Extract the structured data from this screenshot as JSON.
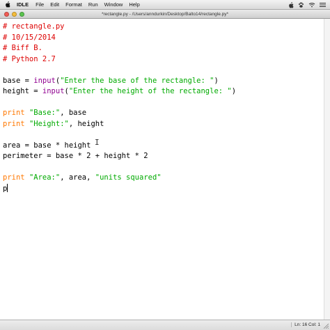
{
  "menubar": {
    "app_name": "IDLE",
    "items": [
      "File",
      "Edit",
      "Format",
      "Run",
      "Window",
      "Help"
    ],
    "status_icons": [
      "apple-icon",
      "paw-icon",
      "wifi-icon",
      "menu-icon"
    ]
  },
  "window": {
    "title": "*rectangle.py - /Users/anndurkin/Desktop/Balto14/rectangle.py*"
  },
  "editor": {
    "lines": [
      [
        {
          "t": "comment",
          "s": "# rectangle.py"
        }
      ],
      [
        {
          "t": "comment",
          "s": "# 10/15/2014"
        }
      ],
      [
        {
          "t": "comment",
          "s": "# Biff B."
        }
      ],
      [
        {
          "t": "comment",
          "s": "# Python 2.7"
        }
      ],
      [],
      [
        {
          "t": "plain",
          "s": "base = "
        },
        {
          "t": "builtin",
          "s": "input"
        },
        {
          "t": "plain",
          "s": "("
        },
        {
          "t": "string",
          "s": "\"Enter the base of the rectangle: \""
        },
        {
          "t": "plain",
          "s": ")"
        }
      ],
      [
        {
          "t": "plain",
          "s": "height = "
        },
        {
          "t": "builtin",
          "s": "input"
        },
        {
          "t": "plain",
          "s": "("
        },
        {
          "t": "string",
          "s": "\"Enter the height of the rectangle: \""
        },
        {
          "t": "plain",
          "s": ")"
        }
      ],
      [],
      [
        {
          "t": "keyword",
          "s": "print"
        },
        {
          "t": "plain",
          "s": " "
        },
        {
          "t": "string",
          "s": "\"Base:\""
        },
        {
          "t": "plain",
          "s": ", base"
        }
      ],
      [
        {
          "t": "keyword",
          "s": "print"
        },
        {
          "t": "plain",
          "s": " "
        },
        {
          "t": "string",
          "s": "\"Height:\""
        },
        {
          "t": "plain",
          "s": ", height"
        }
      ],
      [],
      [
        {
          "t": "plain",
          "s": "area = base * height"
        }
      ],
      [
        {
          "t": "plain",
          "s": "perimeter = base * 2 + height * 2"
        }
      ],
      [],
      [
        {
          "t": "keyword",
          "s": "print"
        },
        {
          "t": "plain",
          "s": " "
        },
        {
          "t": "string",
          "s": "\"Area:\""
        },
        {
          "t": "plain",
          "s": ", area, "
        },
        {
          "t": "string",
          "s": "\"units squared\""
        }
      ],
      [
        {
          "t": "plain",
          "s": "p"
        }
      ]
    ],
    "colors": {
      "comment": "#dd0000",
      "keyword": "#ff7700",
      "builtin": "#900090",
      "string": "#00aa00",
      "plain": "#000000"
    }
  },
  "statusbar": {
    "position": "Ln: 16 Col: 1"
  }
}
